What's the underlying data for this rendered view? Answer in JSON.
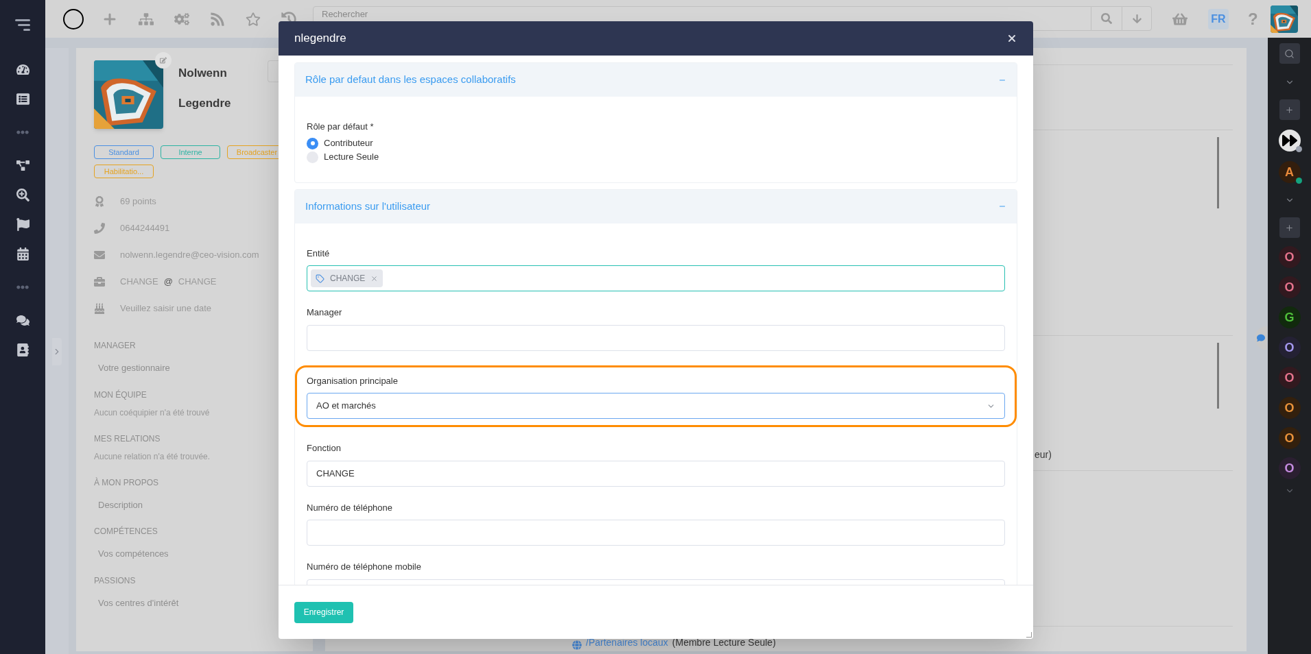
{
  "topbar": {
    "search": {
      "placeholder": "Rechercher"
    },
    "language": "FR",
    "help": "?"
  },
  "profile": {
    "first_name": "Nolwenn",
    "last_name": "Legendre",
    "tags": [
      {
        "label": "Standard",
        "color": "#4a90e2"
      },
      {
        "label": "Interne",
        "color": "#2bb3a3"
      },
      {
        "label": "Broadcaster",
        "color": "#e5a320"
      },
      {
        "label": "Habilitatio...",
        "color": "#e5a320"
      }
    ],
    "details": [
      {
        "kind": "points",
        "text": "69 points"
      },
      {
        "kind": "phone",
        "text": "0644244491"
      },
      {
        "kind": "email",
        "text": "nolwenn.legendre@ceo-vision.com"
      },
      {
        "kind": "job",
        "text": "CHANGE",
        "separator": "@",
        "org": "CHANGE"
      },
      {
        "kind": "birthday",
        "text": "Veuillez saisir une date"
      }
    ],
    "sections": [
      {
        "title": "MANAGER",
        "kind": "field",
        "text": "Votre gestionnaire"
      },
      {
        "title": "MON ÉQUIPE",
        "kind": "note",
        "text": "Aucun coéquipier n'a été trouvé"
      },
      {
        "title": "MES RELATIONS",
        "kind": "note",
        "text": "Aucune relation n'a été trouvée."
      },
      {
        "title": "À MON PROPOS",
        "kind": "field",
        "text": "Description"
      },
      {
        "title": "COMPÉTENCES",
        "kind": "field",
        "text": "Vos compétences"
      },
      {
        "title": "PASSIONS",
        "kind": "field",
        "text": "Vos centres d'intérêt"
      }
    ]
  },
  "background": {
    "fragment": "eur)",
    "membership": {
      "path": "/Partenaires locaux",
      "role": "(Membre Lecture Seule)"
    }
  },
  "right_rail": {
    "contacts": [
      {
        "kind": "media",
        "status": {
          "color": "#9aa0ad"
        }
      },
      {
        "kind": "letter",
        "initial": "A",
        "color": "#e8893a",
        "status": {
          "color": "#14a37f"
        }
      }
    ],
    "groups": [
      {
        "initial": "O",
        "color": "#e5738c"
      },
      {
        "initial": "O",
        "color": "#e5738c"
      },
      {
        "initial": "G",
        "color": "#4fbf3a"
      },
      {
        "initial": "O",
        "color": "#a497ee"
      },
      {
        "initial": "O",
        "color": "#e5738c"
      },
      {
        "initial": "O",
        "color": "#e8923a"
      },
      {
        "initial": "O",
        "color": "#e8923a"
      },
      {
        "initial": "O",
        "color": "#c58be0"
      }
    ]
  },
  "modal": {
    "title": "nlegendre",
    "sections": [
      {
        "title": "Rôle par defaut dans les espaces collaboratifs",
        "expanded": true,
        "fields": [
          {
            "kind": "radio",
            "label": "Rôle par défaut *",
            "options": [
              {
                "label": "Contributeur",
                "selected": true
              },
              {
                "label": "Lecture Seule",
                "selected": false
              }
            ]
          }
        ]
      },
      {
        "title": "Informations sur l'utilisateur",
        "expanded": true,
        "fields": [
          {
            "kind": "tags",
            "label": "Entité",
            "tags": [
              "CHANGE"
            ],
            "highlighted": false
          },
          {
            "kind": "text",
            "label": "Manager",
            "highlighted": false
          },
          {
            "kind": "select",
            "label": "Organisation principale",
            "value": "AO et marchés",
            "highlighted": true
          },
          {
            "kind": "text",
            "label": "Fonction",
            "value": "CHANGE",
            "highlighted": false
          },
          {
            "kind": "text",
            "label": "Numéro de téléphone",
            "highlighted": false
          },
          {
            "kind": "text",
            "label": "Numéro de téléphone mobile",
            "highlighted": false
          }
        ]
      }
    ],
    "save_button": "Enregistrer"
  }
}
